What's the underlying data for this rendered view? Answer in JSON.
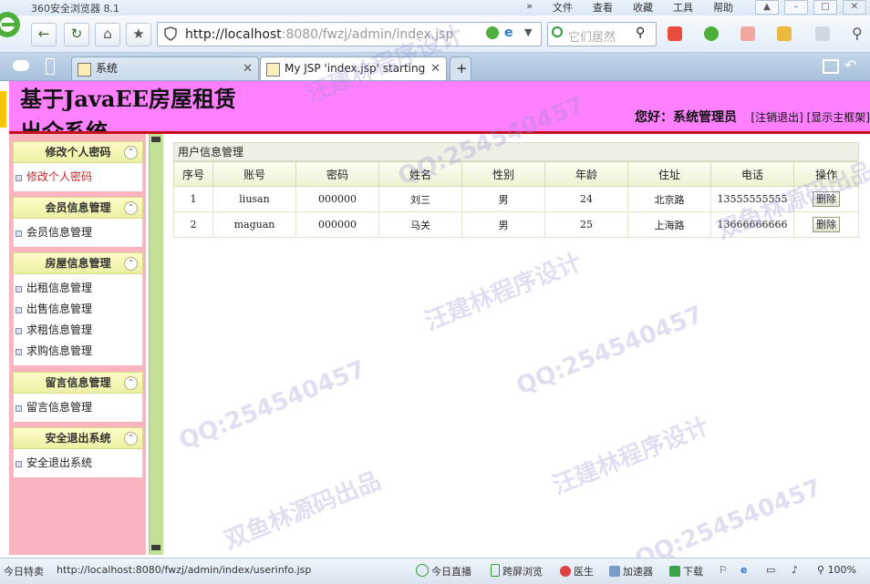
{
  "browser": {
    "name": "360安全浏览器 8.1",
    "menu": [
      "»",
      "文件",
      "查看",
      "收藏",
      "工具",
      "帮助"
    ],
    "address_host": "http://localhost",
    "address_rest": ":8080/fwzj/admin/index.jsp",
    "search_placeholder": "它们居然",
    "tabs": [
      {
        "label": "系统",
        "active": false
      },
      {
        "label": "My JSP 'index.jsp' starting p",
        "active": true
      }
    ],
    "new_tab": "+"
  },
  "header": {
    "title": "基于JavaEE房屋租赁出介系统",
    "welcome": "您好：系统管理员",
    "logout_link": "[注销退出]",
    "frame_link": "[显示主框架]"
  },
  "sidebar": {
    "groups": [
      {
        "title": "修改个人密码",
        "items": [
          "修改个人密码"
        ]
      },
      {
        "title": "会员信息管理",
        "items": [
          "会员信息管理"
        ]
      },
      {
        "title": "房屋信息管理",
        "items": [
          "出租信息管理",
          "出售信息管理",
          "求租信息管理",
          "求购信息管理"
        ]
      },
      {
        "title": "留言信息管理",
        "items": [
          "留言信息管理"
        ]
      },
      {
        "title": "安全退出系统",
        "items": [
          "安全退出系统"
        ]
      }
    ]
  },
  "main": {
    "panel_title": "用户信息管理",
    "columns": [
      "序号",
      "账号",
      "密码",
      "姓名",
      "性别",
      "年龄",
      "住址",
      "电话",
      "操作"
    ],
    "rows": [
      [
        "1",
        "liusan",
        "000000",
        "刘三",
        "男",
        "24",
        "北京路",
        "13555555555",
        "删除"
      ],
      [
        "2",
        "maguan",
        "000000",
        "马关",
        "男",
        "25",
        "上海路",
        "13666666666",
        "删除"
      ]
    ]
  },
  "statusbar": {
    "left": "今日特卖",
    "url": "http://localhost:8080/fwzj/admin/index/userinfo.jsp",
    "live": "今日直播",
    "split": "跨屏浏览",
    "doctor": "医生",
    "accelerator": "加速器",
    "download": "下载",
    "zoom": "100%"
  },
  "watermarks": [
    "QQ:254540457",
    "汪建林程序设计",
    "双鱼林源码出品"
  ],
  "colors": {
    "header_bg": "#ff80ff",
    "header_line": "#c8101a",
    "sidebar_bg": "#fab4bf",
    "splitter": "#c3e098"
  }
}
